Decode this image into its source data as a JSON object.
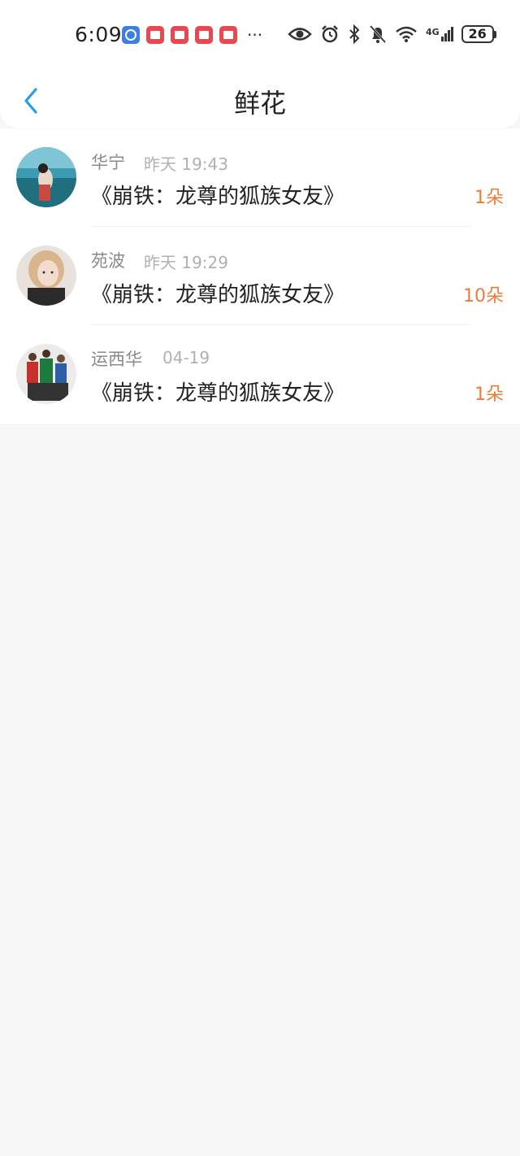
{
  "status_bar": {
    "time": "6:09",
    "more": "···",
    "battery": "26",
    "network": "4G",
    "icons": [
      "clock-app-icon",
      "reader-app-icon",
      "reader-app-icon",
      "reader-app-icon",
      "reader-app-icon",
      "eye-icon",
      "alarm-icon",
      "bluetooth-icon",
      "mute-bell-icon",
      "wifi-icon",
      "signal-icon",
      "battery-icon"
    ]
  },
  "header": {
    "title": "鲜花",
    "back_icon": "chevron-left-icon"
  },
  "colors": {
    "accent": "#2a9be8",
    "count": "#ea7c3a",
    "background": "#f8f7f8"
  },
  "items": [
    {
      "user": "华宁",
      "time": "昨天 19:43",
      "book": "《崩铁：龙尊的狐族女友》",
      "count": "1朵"
    },
    {
      "user": "苑波",
      "time": "昨天 19:29",
      "book": "《崩铁：龙尊的狐族女友》",
      "count": "10朵"
    },
    {
      "user": "运西华",
      "time": "04-19",
      "book": "《崩铁：龙尊的狐族女友》",
      "count": "1朵"
    }
  ]
}
